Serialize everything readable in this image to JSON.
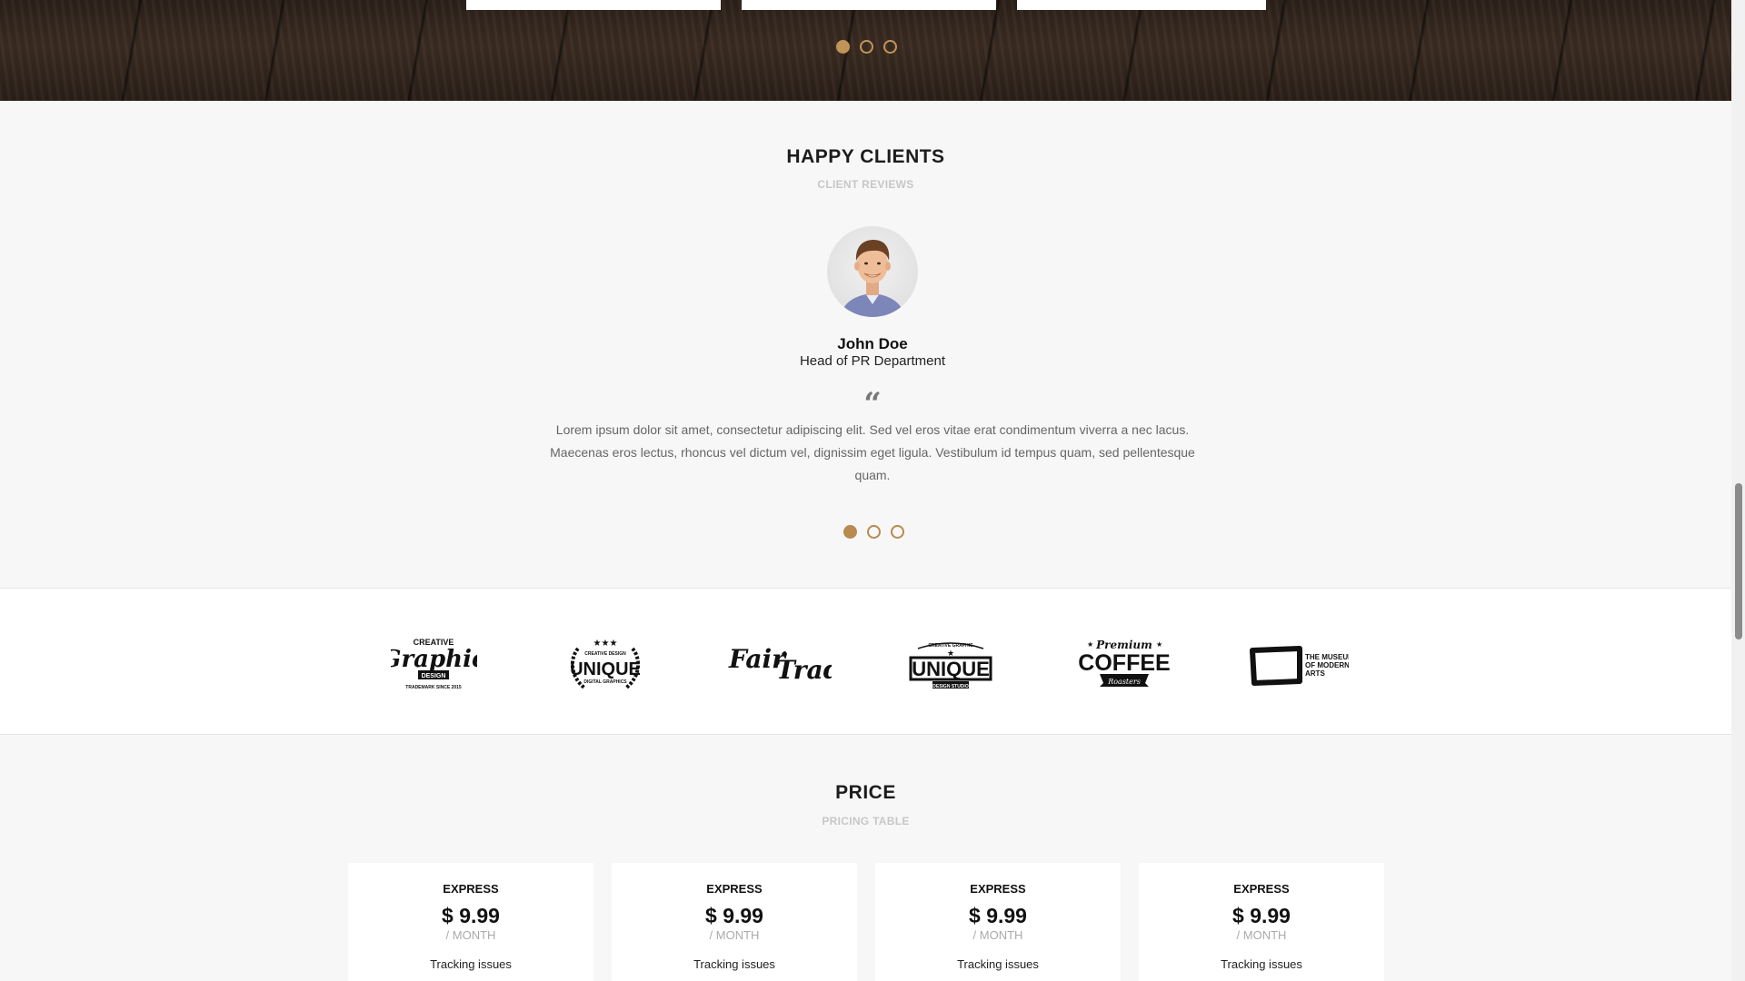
{
  "carousel_top": {
    "dots": 3,
    "active_index": 0
  },
  "clients": {
    "title": "HAPPY CLIENTS",
    "subtitle": "CLIENT REVIEWS",
    "name": "John Doe",
    "role": "Head of PR Department",
    "quote_mark": "“",
    "quote": "Lorem ipsum dolor sit amet, consectetur adipiscing elit. Sed vel eros vitae erat condimentum viverra a nec lacus. Maecenas eros lectus, rhoncus vel dictum vel, dignissim eget ligula. Vestibulum id tempus quam, sed pellentesque quam.",
    "dots": 3,
    "active_index": 0
  },
  "logos": [
    {
      "name": "creative-graphic",
      "top": "CREATIVE",
      "main": "Graphic",
      "sub": "DESIGN",
      "foot": "TRADEMARK SINCE 2015"
    },
    {
      "name": "unique-digital",
      "top": "CREATIVE DESIGN",
      "main": "UNIQUE",
      "sub": "DIGITAL GRAPHICS"
    },
    {
      "name": "fair-trade",
      "main": "Fair",
      "main2": "Trade"
    },
    {
      "name": "unique-studio",
      "top": "CREATIVE GRAPHIC",
      "main": "UNIQUE",
      "sub": "DESIGN STUDIO"
    },
    {
      "name": "premium-coffee",
      "top": "Premium",
      "main": "COFFEE",
      "sub": "Roasters"
    },
    {
      "name": "museum-modern-arts",
      "line1": "THE MUSEUM",
      "line2": "OF MODERN",
      "line3": "ARTS"
    }
  ],
  "pricing": {
    "title": "PRICE",
    "subtitle": "PRICING TABLE",
    "plans": [
      {
        "name": "EXPRESS",
        "price": "$ 9.99",
        "period": "/ MONTH",
        "feature": "Tracking issues"
      },
      {
        "name": "EXPRESS",
        "price": "$ 9.99",
        "period": "/ MONTH",
        "feature": "Tracking issues"
      },
      {
        "name": "EXPRESS",
        "price": "$ 9.99",
        "period": "/ MONTH",
        "feature": "Tracking issues"
      },
      {
        "name": "EXPRESS",
        "price": "$ 9.99",
        "period": "/ MONTH",
        "feature": "Tracking issues"
      }
    ]
  },
  "colors": {
    "accent": "#b88a4e",
    "section_bg": "#f7f7f7",
    "wood": "#2f241c"
  }
}
